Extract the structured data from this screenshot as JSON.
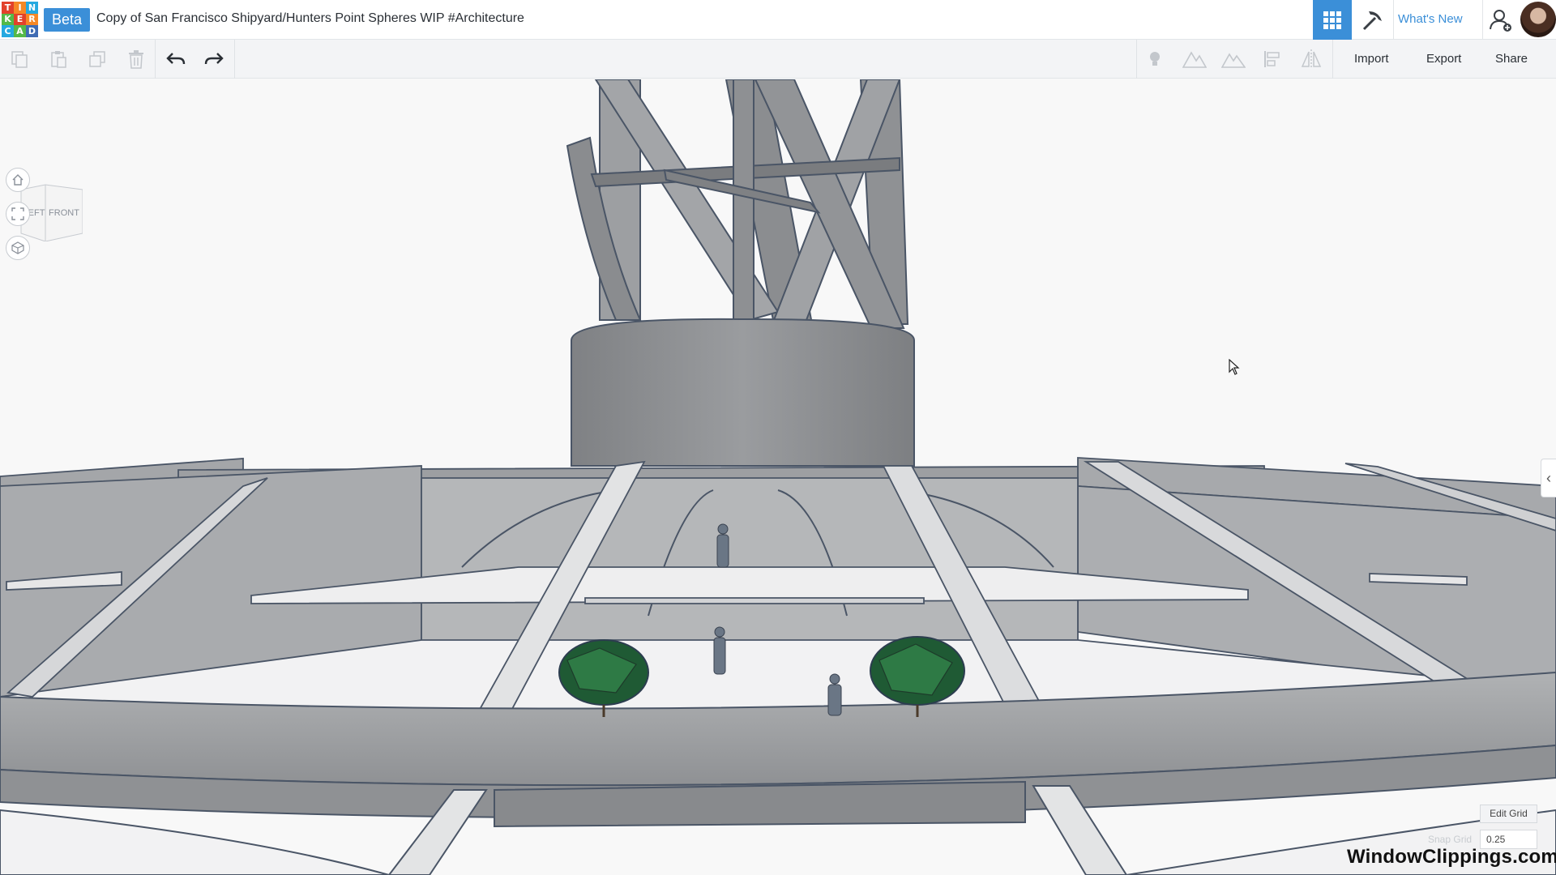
{
  "app": {
    "logo_letters": [
      "T",
      "I",
      "N",
      "K",
      "E",
      "R",
      "C",
      "A",
      "D"
    ],
    "logo_colors": [
      "#e2412b",
      "#f68826",
      "#25a9e0",
      "#54b948",
      "#e2412b",
      "#f68826",
      "#25a9e0",
      "#54b948",
      "#3f6cb4"
    ],
    "beta_label": "Beta",
    "document_title": "Copy of San Francisco Shipyard/Hunters Point Spheres WIP #Architecture",
    "accent_color": "#3b8fd8"
  },
  "topbar": {
    "grid_view_icon": "grid-icon",
    "pickaxe_icon": "pickaxe-icon",
    "whats_new_label": "What's New",
    "add_user_icon": "add-user-icon",
    "avatar_icon": "user-avatar"
  },
  "toolbar": {
    "left_icons": [
      "copy-icon",
      "paste-icon",
      "duplicate-icon",
      "trash-icon",
      "undo-icon",
      "redo-icon"
    ],
    "right_icons": [
      "light-bulb-icon",
      "show-all-icon",
      "hide-icon",
      "align-icon",
      "mirror-icon"
    ],
    "import_label": "Import",
    "export_label": "Export",
    "share_label": "Share"
  },
  "viewcube": {
    "left_label": "LEFT",
    "front_label": "FRONT"
  },
  "nav": [
    "home-view-icon",
    "fit-all-icon",
    "ortho-perspective-icon"
  ],
  "grid": {
    "edit_grid_label": "Edit Grid",
    "snap_grid_label": "Snap Grid",
    "snap_grid_value": "0.25"
  },
  "watermark": "WindowClippings.com"
}
